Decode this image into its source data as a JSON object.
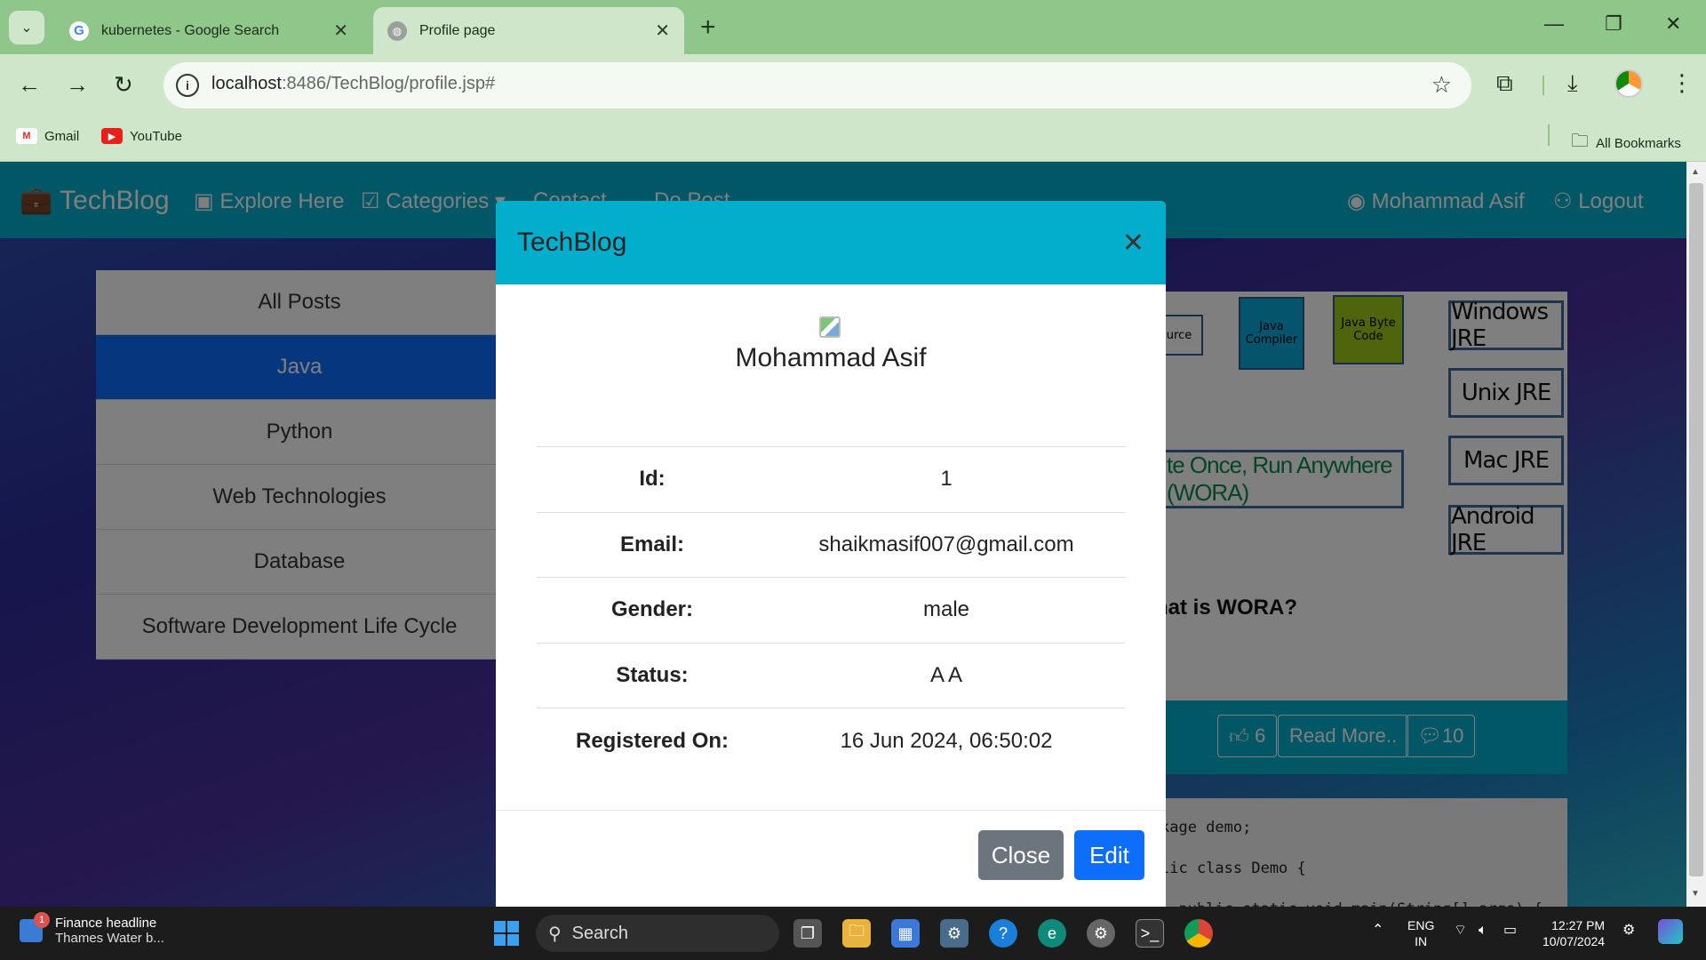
{
  "browser": {
    "tabs": [
      {
        "title": "kubernetes - Google Search",
        "icon": "google-icon"
      },
      {
        "title": "Profile page",
        "icon": "globe-icon"
      }
    ],
    "url_host": "localhost",
    "url_path": ":8486/TechBlog/profile.jsp#",
    "bookmarks": [
      {
        "label": "Gmail",
        "icon": "gmail-icon"
      },
      {
        "label": "YouTube",
        "icon": "youtube-icon"
      }
    ],
    "all_bookmarks": "All Bookmarks"
  },
  "navbar": {
    "brand": "TechBlog",
    "explore": "Explore Here",
    "categories": "Categories",
    "contact": "Contact",
    "do_post": "Do Post",
    "user": "Mohammad Asif",
    "logout": "Logout"
  },
  "sidebar": {
    "items": [
      "All Posts",
      "Java",
      "Python",
      "Web Technologies",
      "Database",
      "Software Development Life Cycle"
    ],
    "active": "Java"
  },
  "post": {
    "diagram": {
      "source": "urce",
      "compiler": "Java Compiler",
      "bytecode": "Java Byte Code",
      "jres": [
        "Windows JRE",
        "Unix JRE",
        "Mac JRE",
        "Android JRE"
      ],
      "wora": "te Once, Run Anywhere (WORA)"
    },
    "title": "hat is WORA?",
    "likes": "6",
    "read_more": "Read More..",
    "comments": "10",
    "code_lines": [
      "kage demo;",
      "lic class Demo {",
      "  public static void main(String[] args) {"
    ]
  },
  "modal": {
    "title": "TechBlog",
    "name": "Mohammad Asif",
    "rows": [
      {
        "key": "Id:",
        "value": "1"
      },
      {
        "key": "Email:",
        "value": "shaikmasif007@gmail.com"
      },
      {
        "key": "Gender:",
        "value": "male"
      },
      {
        "key": "Status:",
        "value": "A A"
      },
      {
        "key": "Registered On:",
        "value": "16 Jun 2024, 06:50:02"
      }
    ],
    "close_label": "Close",
    "edit_label": "Edit"
  },
  "taskbar": {
    "news_badge": "1",
    "news_title": "Finance headline",
    "news_sub": "Thames Water b...",
    "search": "Search",
    "lang1": "ENG",
    "lang2": "IN",
    "time": "12:27 PM",
    "date": "10/07/2024"
  },
  "colors": {
    "navbar": "#03aecd",
    "primary": "#0d6efd",
    "secondary": "#6c757d",
    "chrome_frame": "#8fc68a",
    "chrome_toolbar": "#cfe6cb"
  }
}
